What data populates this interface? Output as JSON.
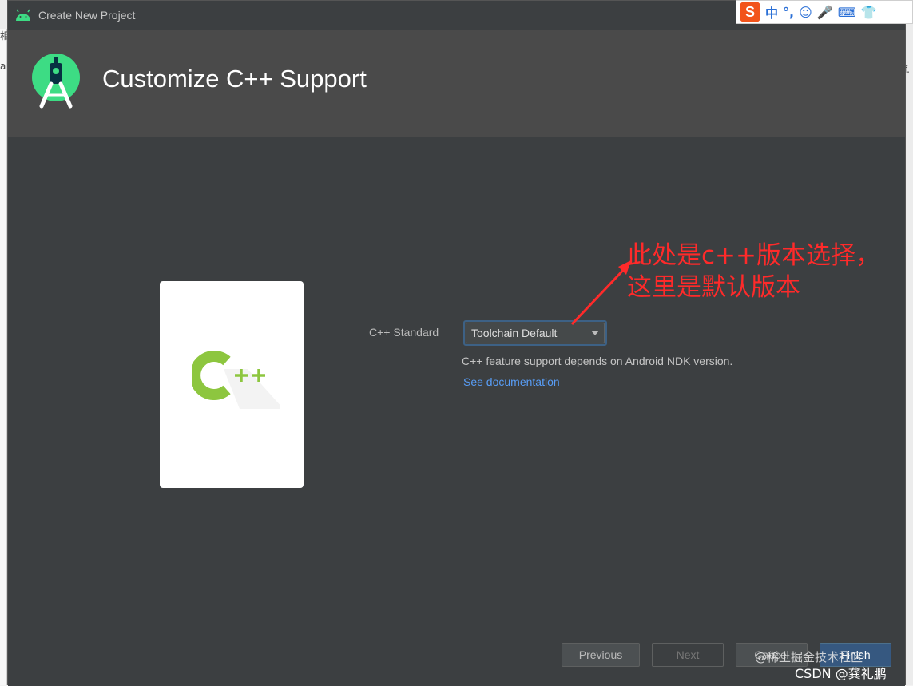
{
  "window": {
    "title": "Create New Project"
  },
  "header": {
    "title": "Customize C++ Support"
  },
  "form": {
    "std_label": "C++ Standard",
    "std_value": "Toolchain Default",
    "feature_text": "C++ feature support depends on Android NDK version.",
    "doc_link": "See documentation"
  },
  "annotation": {
    "line1": "此处是c++版本选择，",
    "line2": "这里是默认版本"
  },
  "buttons": {
    "previous": "Previous",
    "next": "Next",
    "cancel": "Cancel",
    "finish": "Finish"
  },
  "ime": {
    "logo": "S",
    "items": [
      "中",
      "°,",
      "☺",
      "🎤",
      "⌨",
      "👕"
    ]
  },
  "background": {
    "left_top": "相",
    "left_mid": "a",
    "right_mid": "f."
  },
  "watermark": {
    "line1": "@稀土掘金技术社区",
    "line2": "CSDN @龚礼鹏"
  },
  "colors": {
    "accent_blue": "#589df6",
    "cpp_green": "#8dc63f",
    "android_green": "#3ddc84",
    "annotation_red": "#ff2a2a"
  }
}
